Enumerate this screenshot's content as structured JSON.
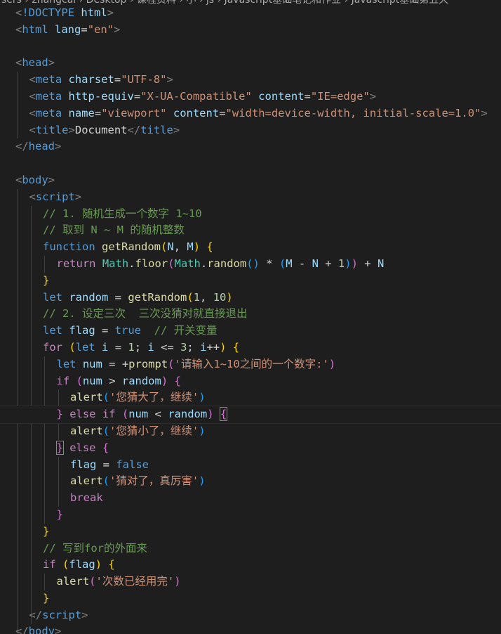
{
  "breadcrumb": "sers › zhangcai › Desktop › 课程资料 › 小 › js › Javascript基础笔记和作业 › Javascript基础第五天",
  "colors": {
    "background": "#1e1e1e",
    "tag": "#569cd6",
    "attribute": "#9cdcfe",
    "string": "#ce9178",
    "comment": "#6a9955",
    "control_keyword": "#c586c0",
    "function": "#dcdcaa",
    "number": "#b5cea8",
    "bracket_level1": "#ffd700",
    "bracket_level2": "#da70d6",
    "bracket_level3": "#179fff"
  },
  "code": [
    {
      "indent": 1,
      "tokens": [
        [
          "br",
          "<"
        ],
        [
          "tag",
          "!DOCTYPE"
        ],
        [
          "text",
          " "
        ],
        [
          "attr",
          "html"
        ],
        [
          "br",
          ">"
        ]
      ]
    },
    {
      "indent": 1,
      "tokens": [
        [
          "br",
          "<"
        ],
        [
          "tag",
          "html"
        ],
        [
          "text",
          " "
        ],
        [
          "attr",
          "lang"
        ],
        [
          "text",
          "="
        ],
        [
          "str",
          "\"en\""
        ],
        [
          "br",
          ">"
        ]
      ]
    },
    {
      "indent": 0,
      "tokens": []
    },
    {
      "indent": 1,
      "tokens": [
        [
          "br",
          "<"
        ],
        [
          "tag",
          "head"
        ],
        [
          "br",
          ">"
        ]
      ]
    },
    {
      "indent": 2,
      "tokens": [
        [
          "br",
          "<"
        ],
        [
          "tag",
          "meta"
        ],
        [
          "text",
          " "
        ],
        [
          "attr",
          "charset"
        ],
        [
          "text",
          "="
        ],
        [
          "str",
          "\"UTF-8\""
        ],
        [
          "br",
          ">"
        ]
      ]
    },
    {
      "indent": 2,
      "tokens": [
        [
          "br",
          "<"
        ],
        [
          "tag",
          "meta"
        ],
        [
          "text",
          " "
        ],
        [
          "attr",
          "http-equiv"
        ],
        [
          "text",
          "="
        ],
        [
          "str",
          "\"X-UA-Compatible\""
        ],
        [
          "text",
          " "
        ],
        [
          "attr",
          "content"
        ],
        [
          "text",
          "="
        ],
        [
          "str",
          "\"IE=edge\""
        ],
        [
          "br",
          ">"
        ]
      ]
    },
    {
      "indent": 2,
      "tokens": [
        [
          "br",
          "<"
        ],
        [
          "tag",
          "meta"
        ],
        [
          "text",
          " "
        ],
        [
          "attr",
          "name"
        ],
        [
          "text",
          "="
        ],
        [
          "str",
          "\"viewport\""
        ],
        [
          "text",
          " "
        ],
        [
          "attr",
          "content"
        ],
        [
          "text",
          "="
        ],
        [
          "str",
          "\"width=device-width, initial-scale=1.0\""
        ],
        [
          "br",
          ">"
        ]
      ]
    },
    {
      "indent": 2,
      "tokens": [
        [
          "br",
          "<"
        ],
        [
          "tag",
          "title"
        ],
        [
          "br",
          ">"
        ],
        [
          "text",
          "Document"
        ],
        [
          "br",
          "</"
        ],
        [
          "tag",
          "title"
        ],
        [
          "br",
          ">"
        ]
      ]
    },
    {
      "indent": 1,
      "tokens": [
        [
          "br",
          "</"
        ],
        [
          "tag",
          "head"
        ],
        [
          "br",
          ">"
        ]
      ]
    },
    {
      "indent": 0,
      "tokens": []
    },
    {
      "indent": 1,
      "tokens": [
        [
          "br",
          "<"
        ],
        [
          "tag",
          "body"
        ],
        [
          "br",
          ">"
        ]
      ]
    },
    {
      "indent": 2,
      "tokens": [
        [
          "br",
          "<"
        ],
        [
          "tag",
          "script"
        ],
        [
          "br",
          ">"
        ]
      ]
    },
    {
      "indent": 3,
      "tokens": [
        [
          "cmt",
          "// 1. 随机生成一个数字 1~10"
        ]
      ]
    },
    {
      "indent": 3,
      "tokens": [
        [
          "cmt",
          "// 取到 N ~ M 的随机整数"
        ]
      ]
    },
    {
      "indent": 3,
      "tokens": [
        [
          "kw",
          "function"
        ],
        [
          "text",
          " "
        ],
        [
          "fn",
          "getRandom"
        ],
        [
          "b1",
          "("
        ],
        [
          "var",
          "N"
        ],
        [
          "text",
          ", "
        ],
        [
          "var",
          "M"
        ],
        [
          "b1",
          ")"
        ],
        [
          "text",
          " "
        ],
        [
          "b1",
          "{"
        ]
      ]
    },
    {
      "indent": 4,
      "tokens": [
        [
          "ctl",
          "return"
        ],
        [
          "text",
          " "
        ],
        [
          "obj",
          "Math"
        ],
        [
          "text",
          "."
        ],
        [
          "fn",
          "floor"
        ],
        [
          "b2",
          "("
        ],
        [
          "obj",
          "Math"
        ],
        [
          "text",
          "."
        ],
        [
          "fn",
          "random"
        ],
        [
          "b3",
          "()"
        ],
        [
          "text",
          " * "
        ],
        [
          "b3",
          "("
        ],
        [
          "var",
          "M"
        ],
        [
          "text",
          " - "
        ],
        [
          "var",
          "N"
        ],
        [
          "text",
          " + "
        ],
        [
          "num",
          "1"
        ],
        [
          "b3",
          ")"
        ],
        [
          "b2",
          ")"
        ],
        [
          "text",
          " + "
        ],
        [
          "var",
          "N"
        ]
      ]
    },
    {
      "indent": 3,
      "tokens": [
        [
          "b1",
          "}"
        ]
      ]
    },
    {
      "indent": 3,
      "tokens": [
        [
          "kw",
          "let"
        ],
        [
          "text",
          " "
        ],
        [
          "var",
          "random"
        ],
        [
          "text",
          " = "
        ],
        [
          "fn",
          "getRandom"
        ],
        [
          "b1",
          "("
        ],
        [
          "num",
          "1"
        ],
        [
          "text",
          ", "
        ],
        [
          "num",
          "10"
        ],
        [
          "b1",
          ")"
        ]
      ]
    },
    {
      "indent": 3,
      "tokens": [
        [
          "cmt",
          "// 2. 设定三次  三次没猜对就直接退出"
        ]
      ]
    },
    {
      "indent": 3,
      "tokens": [
        [
          "kw",
          "let"
        ],
        [
          "text",
          " "
        ],
        [
          "var",
          "flag"
        ],
        [
          "text",
          " = "
        ],
        [
          "kw",
          "true"
        ],
        [
          "text",
          "  "
        ],
        [
          "cmt",
          "// 开关变量"
        ]
      ]
    },
    {
      "indent": 3,
      "tokens": [
        [
          "ctl",
          "for"
        ],
        [
          "text",
          " "
        ],
        [
          "b1",
          "("
        ],
        [
          "kw",
          "let"
        ],
        [
          "text",
          " "
        ],
        [
          "var",
          "i"
        ],
        [
          "text",
          " = "
        ],
        [
          "num",
          "1"
        ],
        [
          "text",
          "; "
        ],
        [
          "var",
          "i"
        ],
        [
          "text",
          " <= "
        ],
        [
          "num",
          "3"
        ],
        [
          "text",
          "; "
        ],
        [
          "var",
          "i"
        ],
        [
          "text",
          "++"
        ],
        [
          "b1",
          ")"
        ],
        [
          "text",
          " "
        ],
        [
          "b1",
          "{"
        ]
      ]
    },
    {
      "indent": 4,
      "tokens": [
        [
          "kw",
          "let"
        ],
        [
          "text",
          " "
        ],
        [
          "var",
          "num"
        ],
        [
          "text",
          " = +"
        ],
        [
          "fn",
          "prompt"
        ],
        [
          "b2",
          "("
        ],
        [
          "str",
          "'请输入1~10之间的一个数字:'"
        ],
        [
          "b2",
          ")"
        ]
      ]
    },
    {
      "indent": 4,
      "tokens": [
        [
          "ctl",
          "if"
        ],
        [
          "text",
          " "
        ],
        [
          "b2",
          "("
        ],
        [
          "var",
          "num"
        ],
        [
          "text",
          " > "
        ],
        [
          "var",
          "random"
        ],
        [
          "b2",
          ")"
        ],
        [
          "text",
          " "
        ],
        [
          "b2",
          "{"
        ]
      ]
    },
    {
      "indent": 5,
      "tokens": [
        [
          "fn",
          "alert"
        ],
        [
          "b3",
          "("
        ],
        [
          "str",
          "'您猜大了，继续'"
        ],
        [
          "b3",
          ")"
        ]
      ]
    },
    {
      "indent": 4,
      "active": true,
      "tokens": [
        [
          "b2",
          "}"
        ],
        [
          "text",
          " "
        ],
        [
          "ctl",
          "else"
        ],
        [
          "text",
          " "
        ],
        [
          "ctl",
          "if"
        ],
        [
          "text",
          " "
        ],
        [
          "b2",
          "("
        ],
        [
          "var",
          "num"
        ],
        [
          "text",
          " < "
        ],
        [
          "var",
          "random"
        ],
        [
          "b2",
          ")"
        ],
        [
          "text",
          " "
        ],
        [
          "b2m",
          "{"
        ]
      ]
    },
    {
      "indent": 5,
      "tokens": [
        [
          "fn",
          "alert"
        ],
        [
          "b3",
          "("
        ],
        [
          "str",
          "'您猜小了，继续'"
        ],
        [
          "b3",
          ")"
        ]
      ]
    },
    {
      "indent": 4,
      "tokens": [
        [
          "b2m",
          "}"
        ],
        [
          "text",
          " "
        ],
        [
          "ctl",
          "else"
        ],
        [
          "text",
          " "
        ],
        [
          "b2",
          "{"
        ]
      ]
    },
    {
      "indent": 5,
      "tokens": [
        [
          "var",
          "flag"
        ],
        [
          "text",
          " = "
        ],
        [
          "kw",
          "false"
        ]
      ]
    },
    {
      "indent": 5,
      "tokens": [
        [
          "fn",
          "alert"
        ],
        [
          "b3",
          "("
        ],
        [
          "str",
          "'猜对了，真厉害'"
        ],
        [
          "b3",
          ")"
        ]
      ]
    },
    {
      "indent": 5,
      "tokens": [
        [
          "ctl",
          "break"
        ]
      ]
    },
    {
      "indent": 4,
      "tokens": [
        [
          "b2",
          "}"
        ]
      ]
    },
    {
      "indent": 3,
      "tokens": [
        [
          "b1",
          "}"
        ]
      ]
    },
    {
      "indent": 3,
      "tokens": [
        [
          "cmt",
          "// 写到for的外面来"
        ]
      ]
    },
    {
      "indent": 3,
      "tokens": [
        [
          "ctl",
          "if"
        ],
        [
          "text",
          " "
        ],
        [
          "b1",
          "("
        ],
        [
          "var",
          "flag"
        ],
        [
          "b1",
          ")"
        ],
        [
          "text",
          " "
        ],
        [
          "b1",
          "{"
        ]
      ]
    },
    {
      "indent": 4,
      "tokens": [
        [
          "fn",
          "alert"
        ],
        [
          "b2",
          "("
        ],
        [
          "str",
          "'次数已经用完'"
        ],
        [
          "b2",
          ")"
        ]
      ]
    },
    {
      "indent": 3,
      "tokens": [
        [
          "b1",
          "}"
        ]
      ]
    },
    {
      "indent": 2,
      "tokens": [
        [
          "br",
          "</"
        ],
        [
          "tag",
          "script"
        ],
        [
          "br",
          ">"
        ]
      ]
    },
    {
      "indent": 1,
      "tokens": [
        [
          "br",
          "</"
        ],
        [
          "tag",
          "body"
        ],
        [
          "br",
          ">"
        ]
      ]
    }
  ]
}
